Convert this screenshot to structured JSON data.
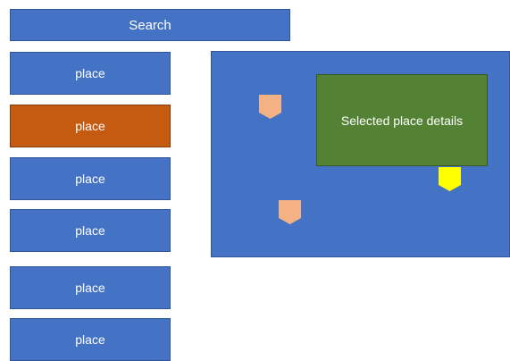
{
  "search": {
    "label": "Search"
  },
  "places": [
    {
      "label": "place",
      "selected": false
    },
    {
      "label": "place",
      "selected": true
    },
    {
      "label": "place",
      "selected": false
    },
    {
      "label": "place",
      "selected": false
    },
    {
      "label": "place",
      "selected": false
    },
    {
      "label": "place",
      "selected": false
    }
  ],
  "map": {
    "details_label": "Selected place details",
    "pins": [
      {
        "icon": "map-pin-icon",
        "color": "#f4b183"
      },
      {
        "icon": "map-pin-icon",
        "color": "#ffff00"
      },
      {
        "icon": "map-pin-icon",
        "color": "#f4b183"
      }
    ]
  },
  "colors": {
    "list_background": "#4472c4",
    "selected_background": "#c55a11",
    "details_background": "#548235",
    "text": "#ffffff"
  }
}
